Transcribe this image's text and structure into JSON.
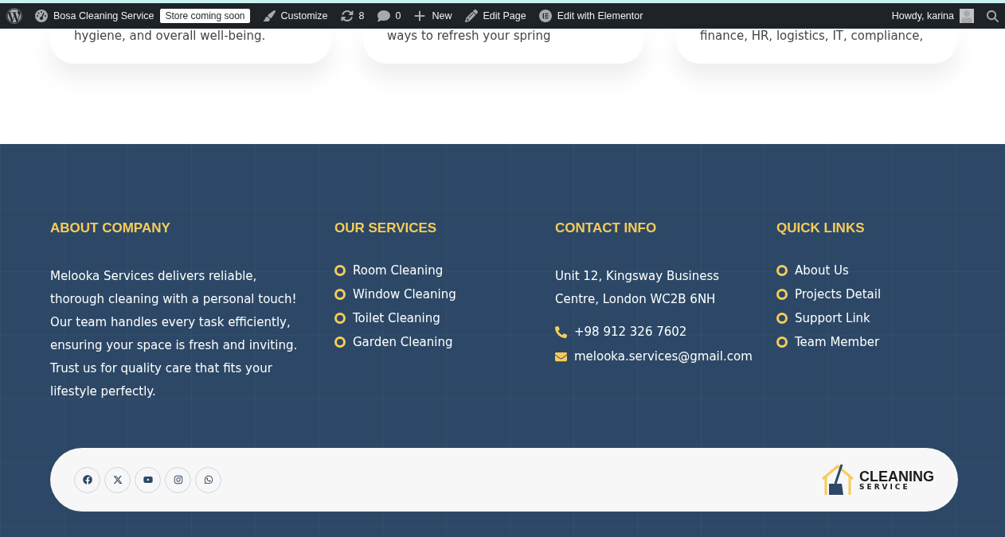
{
  "admin_bar": {
    "site": "Bosa Cleaning Service",
    "badge": "Store coming soon",
    "items": [
      {
        "kind": "customize",
        "label": "Customize"
      },
      {
        "kind": "updates",
        "label": "8"
      },
      {
        "kind": "comments",
        "label": "0"
      },
      {
        "kind": "new",
        "label": "New"
      },
      {
        "kind": "edit",
        "label": "Edit Page"
      },
      {
        "kind": "elementor",
        "label": "Edit with Elementor"
      }
    ],
    "greeting": "Howdy, karina"
  },
  "cards": [
    "hygiene, and overall well-being.",
    "ways to refresh your spring",
    "finance, HR, logistics, IT, compliance,"
  ],
  "footer": {
    "about": {
      "title": "ABOUT COMPANY",
      "text": "Melooka Services delivers reliable, thorough cleaning with a personal touch! Our team handles every task efficiently, ensuring your space is fresh and inviting. Trust us for quality care that fits your lifestyle perfectly."
    },
    "services": {
      "title": "OUR SERVICES",
      "items": [
        "Room Cleaning",
        "Window Cleaning",
        "Toilet Cleaning",
        "Garden Cleaning"
      ]
    },
    "contact": {
      "title": "CONTACT INFO",
      "address": "Unit 12, Kingsway Business Centre, London WC2B 6NH",
      "phone": "+98 912 326 7602",
      "email": "melooka.services@gmail.com"
    },
    "links": {
      "title": "QUICK LINKS",
      "items": [
        "About Us",
        "Projects Detail",
        "Support Link",
        "Team Member"
      ]
    },
    "social": [
      {
        "kind": "facebook"
      },
      {
        "kind": "x"
      },
      {
        "kind": "youtube"
      },
      {
        "kind": "instagram"
      },
      {
        "kind": "whatsapp"
      }
    ],
    "logo": {
      "title": "CLEANING",
      "subtitle": "SERVICE"
    }
  }
}
